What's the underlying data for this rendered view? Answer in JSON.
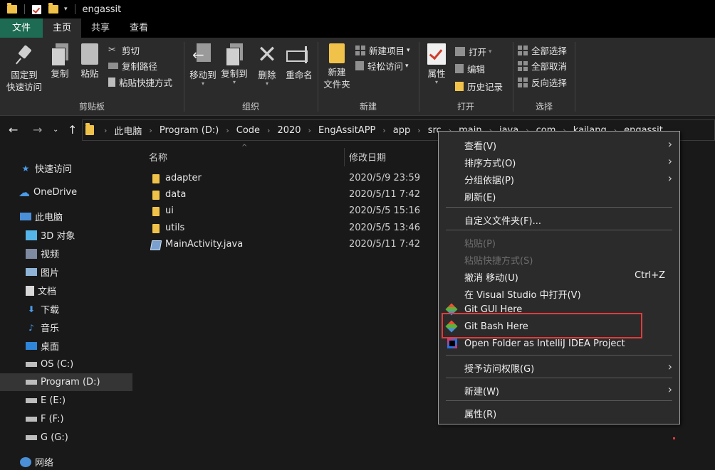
{
  "window": {
    "title": "engassit"
  },
  "tabs": [
    "文件",
    "主页",
    "共享",
    "查看"
  ],
  "ribbon": {
    "clipboard": {
      "label": "剪贴板",
      "pin": [
        "固定到",
        "快速访问"
      ],
      "copy": "复制",
      "paste": "粘贴",
      "cut": "剪切",
      "copy_path": "复制路径",
      "paste_shortcut": "粘贴快捷方式"
    },
    "organize": {
      "label": "组织",
      "move_to": "移动到",
      "copy_to": "复制到",
      "delete": "删除",
      "rename": "重命名"
    },
    "new": {
      "label": "新建",
      "new_folder": [
        "新建",
        "文件夹"
      ],
      "new_item": "新建项目",
      "easy_access": "轻松访问"
    },
    "open": {
      "label": "打开",
      "properties": "属性",
      "open": "打开",
      "edit": "编辑",
      "history": "历史记录"
    },
    "select": {
      "label": "选择",
      "select_all": "全部选择",
      "select_none": "全部取消",
      "invert": "反向选择"
    }
  },
  "address": {
    "crumbs": [
      "此电脑",
      "Program (D:)",
      "Code",
      "2020",
      "EngAssitAPP",
      "app",
      "src",
      "main",
      "java",
      "com",
      "kailang",
      "engassit"
    ]
  },
  "sidebar": {
    "items": [
      {
        "label": "快速访问",
        "icon": "star-icon"
      },
      {
        "label": "OneDrive",
        "icon": "cloud-icon"
      },
      {
        "label": "此电脑",
        "icon": "computer-icon"
      },
      {
        "label": "3D 对象",
        "icon": "cube-icon"
      },
      {
        "label": "视频",
        "icon": "film-icon"
      },
      {
        "label": "图片",
        "icon": "picture-icon"
      },
      {
        "label": "文档",
        "icon": "document-icon"
      },
      {
        "label": "下载",
        "icon": "download-icon"
      },
      {
        "label": "音乐",
        "icon": "music-icon"
      },
      {
        "label": "桌面",
        "icon": "desktop-icon"
      },
      {
        "label": "OS (C:)",
        "icon": "drive-icon"
      },
      {
        "label": "Program (D:)",
        "icon": "drive-icon"
      },
      {
        "label": "E (E:)",
        "icon": "drive-icon"
      },
      {
        "label": "F (F:)",
        "icon": "drive-icon"
      },
      {
        "label": "G (G:)",
        "icon": "drive-icon"
      },
      {
        "label": "网络",
        "icon": "network-icon"
      }
    ]
  },
  "files": {
    "headers": {
      "name": "名称",
      "date": "修改日期"
    },
    "rows": [
      {
        "name": "adapter",
        "date": "2020/5/9 23:59",
        "icon": "folder-icon"
      },
      {
        "name": "data",
        "date": "2020/5/11 7:42",
        "icon": "folder-icon"
      },
      {
        "name": "ui",
        "date": "2020/5/5 15:16",
        "icon": "folder-icon"
      },
      {
        "name": "utils",
        "date": "2020/5/5 13:46",
        "icon": "folder-icon"
      },
      {
        "name": "MainActivity.java",
        "date": "2020/5/11 7:42",
        "icon": "java-file-icon"
      }
    ]
  },
  "context_menu": {
    "items": [
      {
        "label": "查看(V)",
        "submenu": true
      },
      {
        "label": "排序方式(O)",
        "submenu": true
      },
      {
        "label": "分组依据(P)",
        "submenu": true
      },
      {
        "label": "刷新(E)"
      },
      {
        "label": "自定义文件夹(F)..."
      },
      {
        "label": "粘贴(P)",
        "disabled": true
      },
      {
        "label": "粘贴快捷方式(S)",
        "disabled": true
      },
      {
        "label": "撤消 移动(U)",
        "shortcut": "Ctrl+Z"
      },
      {
        "label": "在 Visual Studio 中打开(V)"
      },
      {
        "label": "Git GUI Here",
        "icon": "git-icon"
      },
      {
        "label": "Git Bash Here",
        "icon": "git-icon",
        "highlighted": true
      },
      {
        "label": "Open Folder as IntelliJ IDEA Project",
        "icon": "intellij-icon"
      },
      {
        "label": "授予访问权限(G)",
        "submenu": true
      },
      {
        "label": "新建(W)",
        "submenu": true
      },
      {
        "label": "属性(R)"
      }
    ]
  },
  "colors": {
    "accent_file_tab": "#1c6b52",
    "highlight_border": "#e03c3c",
    "folder": "#f0c24a"
  }
}
